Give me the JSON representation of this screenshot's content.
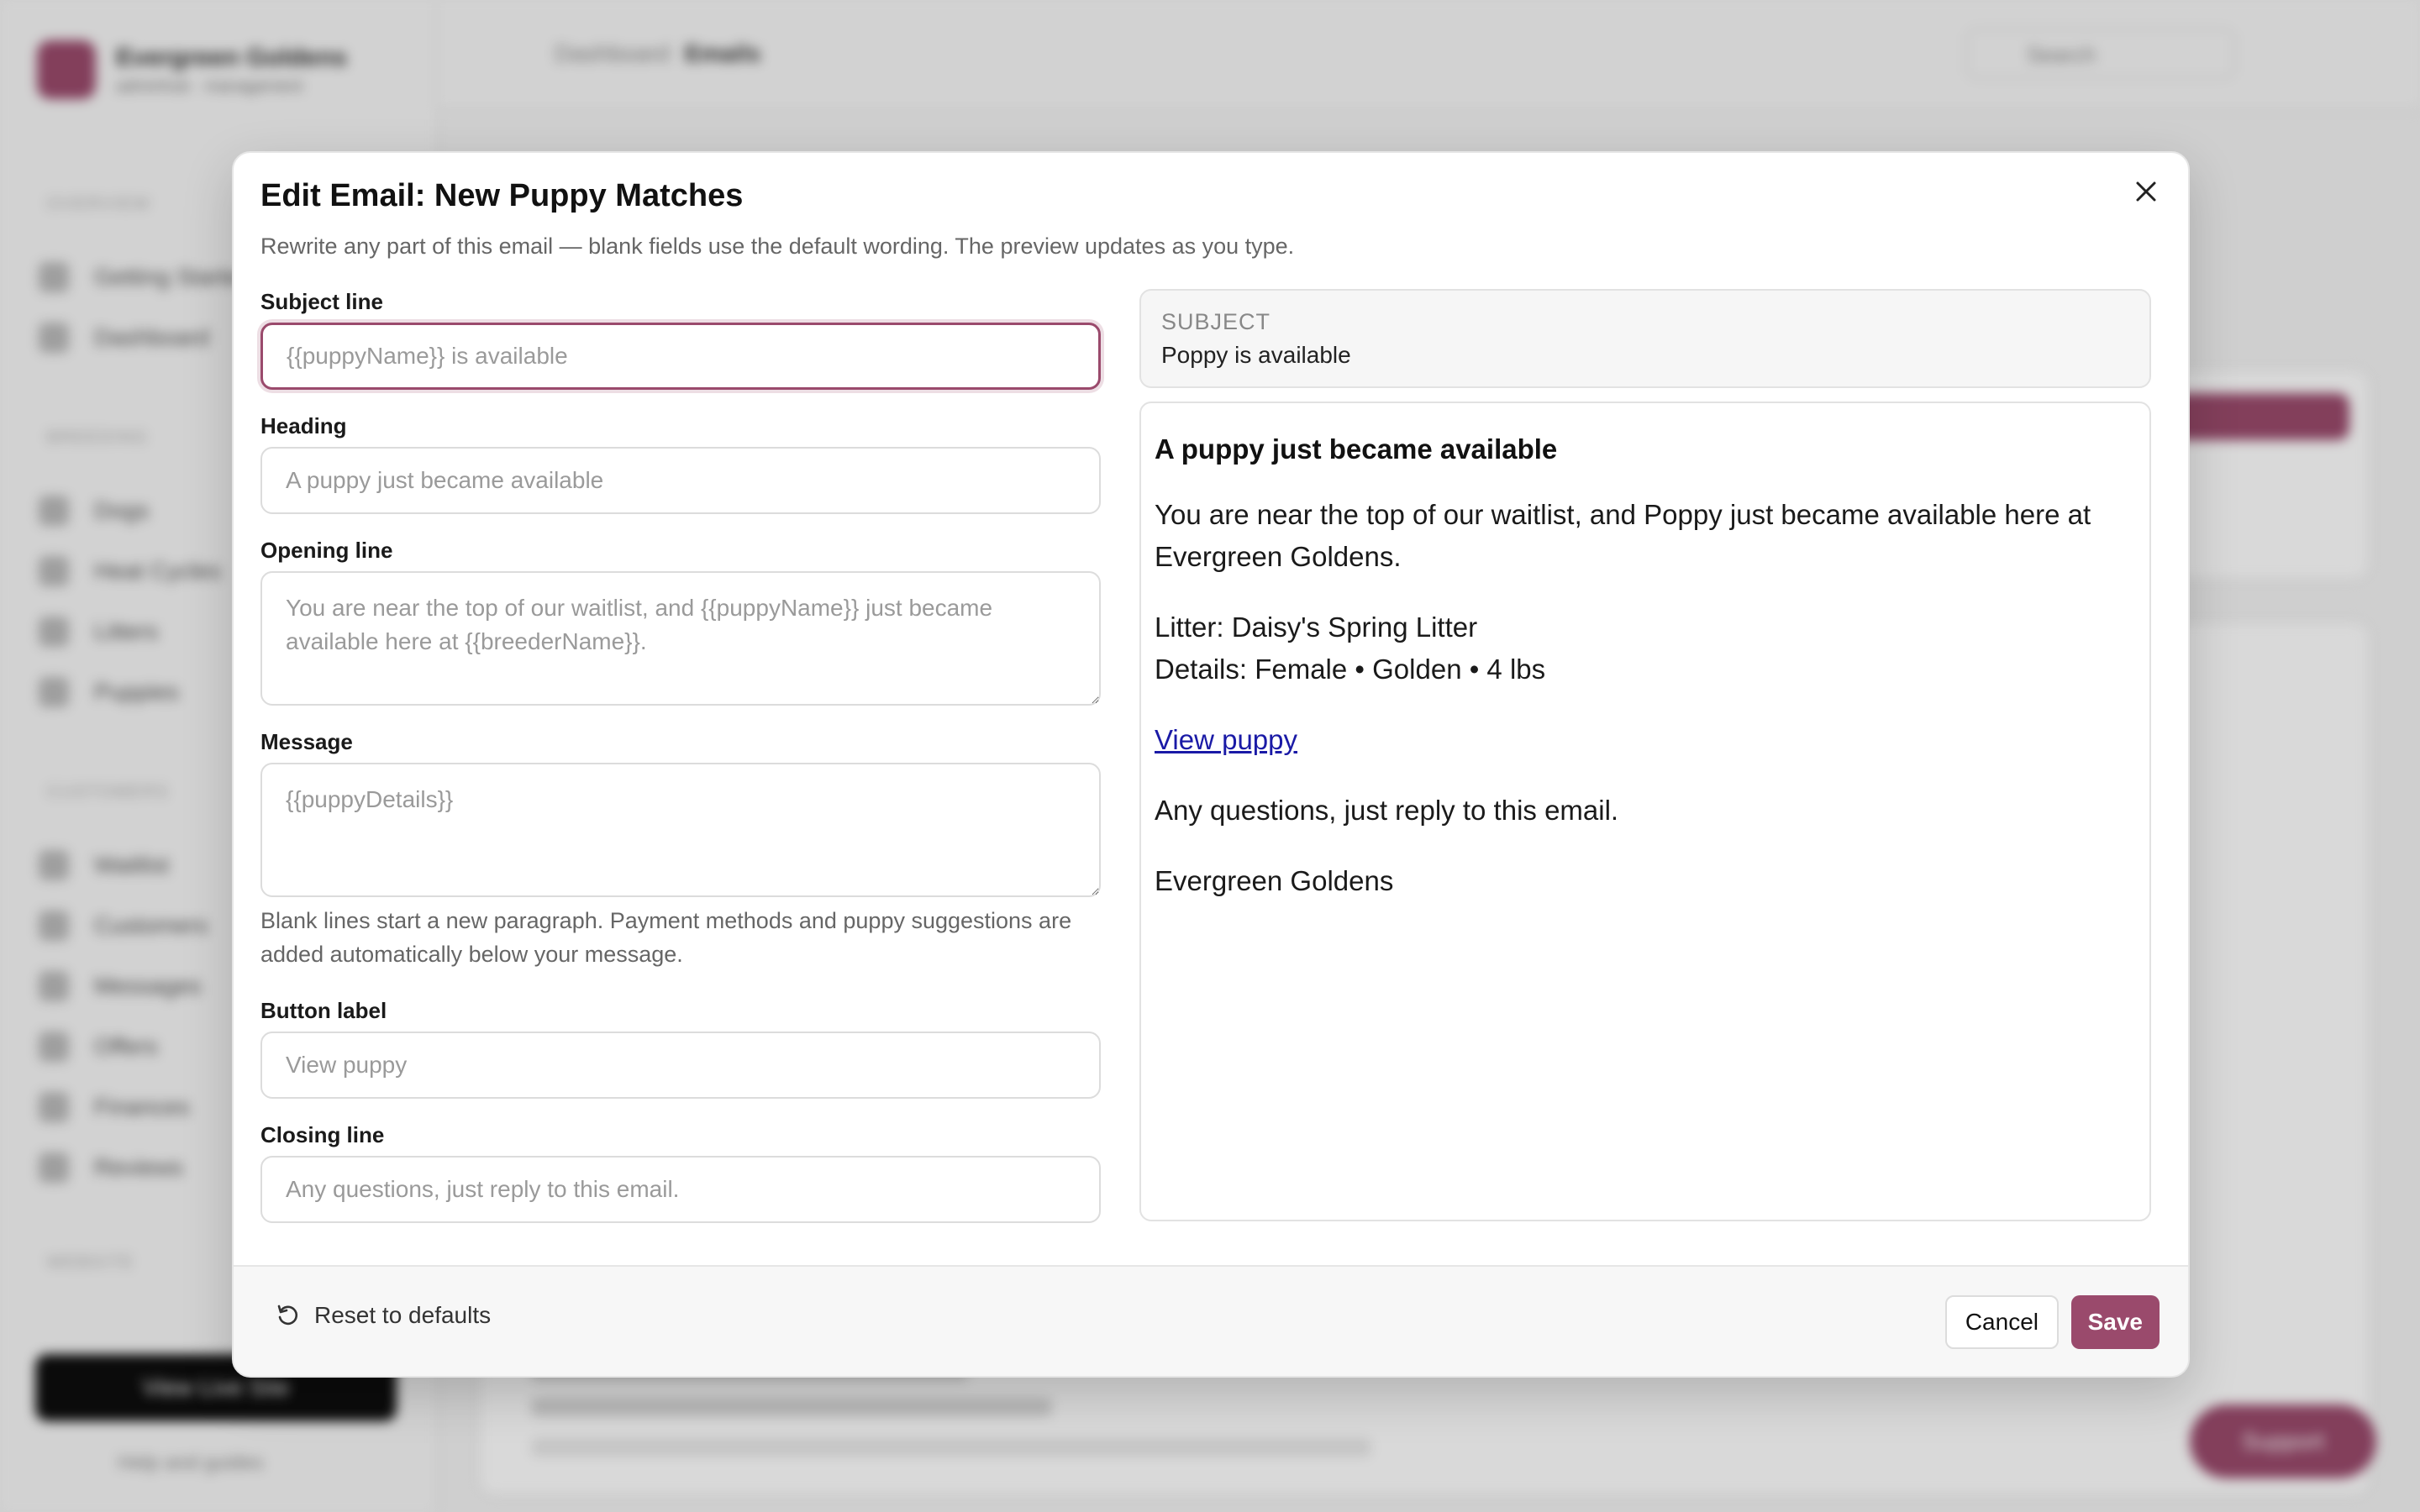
{
  "background": {
    "brand": {
      "name": "Evergreen Goldens",
      "subtitle": "adminhub · management"
    },
    "nav_sections": [
      "OVERVIEW",
      "BREEDING",
      "CUSTOMERS",
      "WEBSITE"
    ],
    "nav_items": [
      "Getting Started",
      "Dashboard",
      "Dogs",
      "Heat Cycles",
      "Litters",
      "Puppies",
      "Waitlist",
      "Customers",
      "Messages",
      "Offers",
      "Finances",
      "Reviews"
    ],
    "view_live_label": "View Live Site",
    "help_label": "Help and guides",
    "breadcrumb": {
      "parent": "Dashboard",
      "current": "Emails"
    },
    "search_label": "Search",
    "support_label": "Support"
  },
  "modal": {
    "title": "Edit Email: New Puppy Matches",
    "description": "Rewrite any part of this email — blank fields use the default wording. The preview updates as you type.",
    "fields": {
      "subject": {
        "label": "Subject line",
        "value": "",
        "placeholder": "{{puppyName}} is available"
      },
      "heading": {
        "label": "Heading",
        "value": "",
        "placeholder": "A puppy just became available"
      },
      "opening": {
        "label": "Opening line",
        "value": "",
        "placeholder": "You are near the top of our waitlist, and {{puppyName}} just became available here at {{breederName}}."
      },
      "message": {
        "label": "Message",
        "value": "",
        "placeholder": "{{puppyDetails}}"
      },
      "message_help": "Blank lines start a new paragraph. Payment methods and puppy suggestions are added automatically below your message.",
      "button_label": {
        "label": "Button label",
        "value": "",
        "placeholder": "View puppy"
      },
      "closing": {
        "label": "Closing line",
        "value": "",
        "placeholder": "Any questions, just reply to this email."
      }
    },
    "preview": {
      "subject_kicker": "SUBJECT",
      "subject": "Poppy is available",
      "heading": "A puppy just became available",
      "opening": "You are near the top of our waitlist, and Poppy just became available here at Evergreen Goldens.",
      "litter": "Litter: Daisy's Spring Litter",
      "details": "Details: Female • Golden • 4 lbs",
      "link": "View puppy",
      "closing": "Any questions, just reply to this email.",
      "signature": "Evergreen Goldens"
    },
    "footer": {
      "reset_label": "Reset to defaults",
      "cancel_label": "Cancel",
      "save_label": "Save"
    }
  },
  "colors": {
    "accent": "#9a4a6c",
    "link": "#1a1aa6",
    "focus_ring": "#9a4a6c"
  }
}
